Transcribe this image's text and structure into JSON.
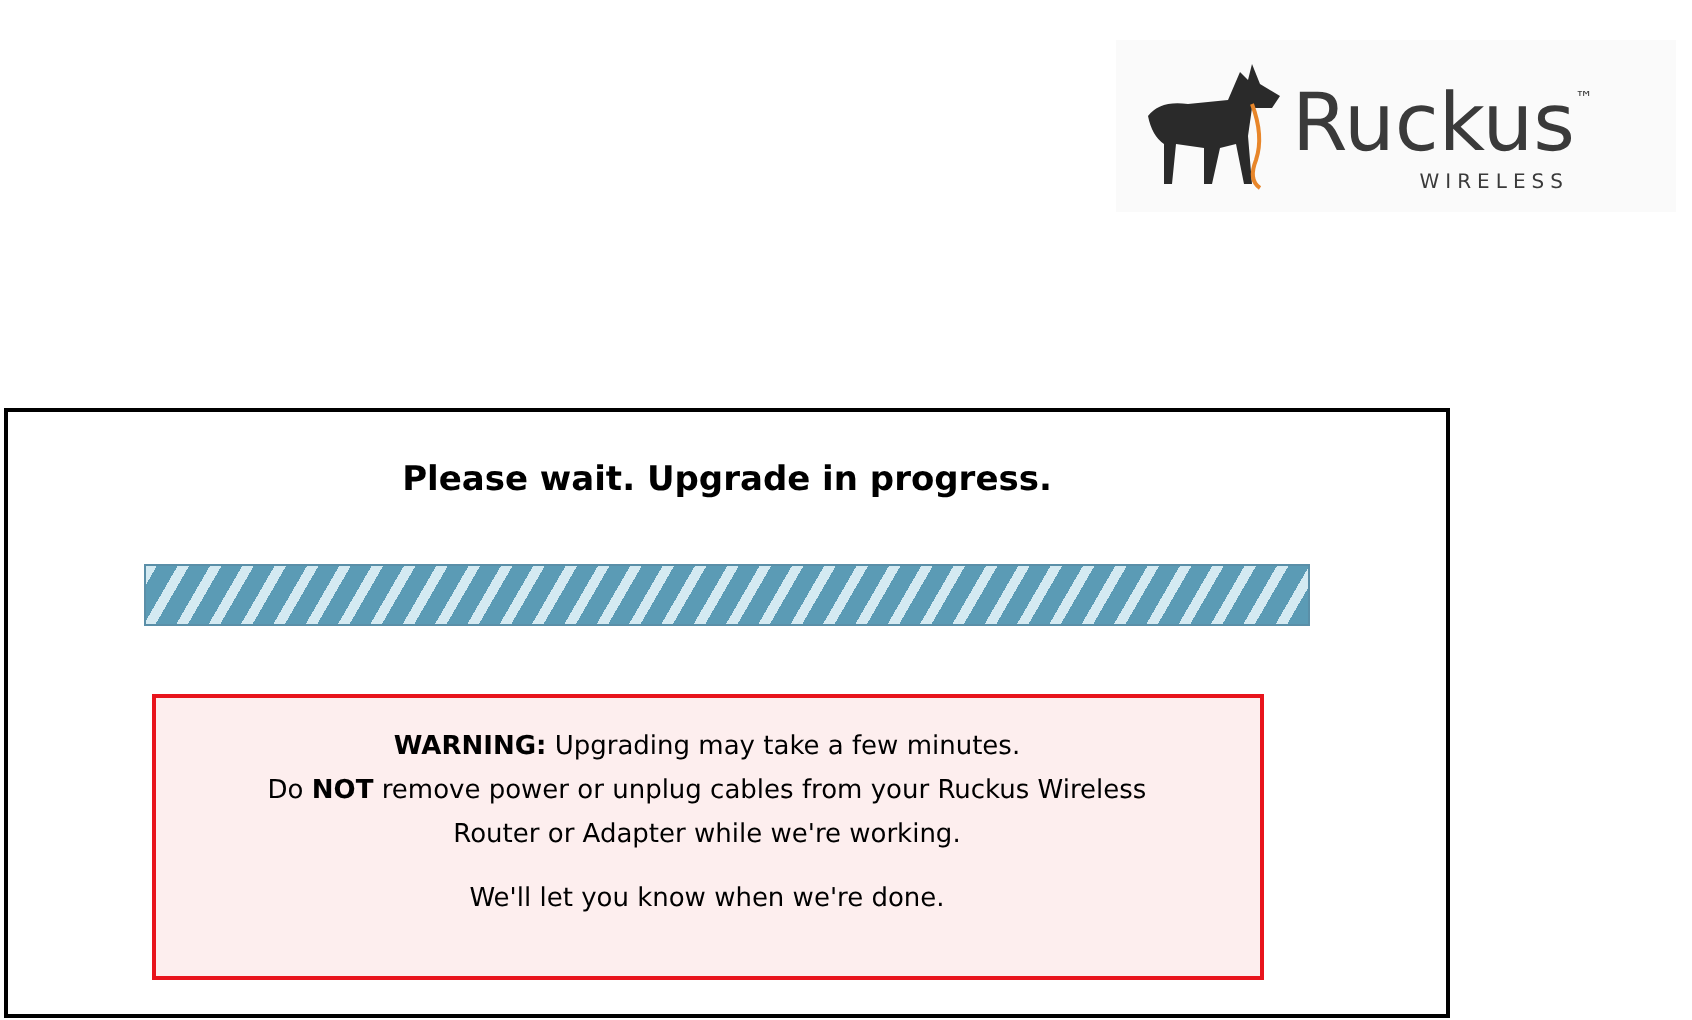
{
  "logo": {
    "name": "Ruckus",
    "trademark": "™",
    "tagline": "WIRELESS"
  },
  "status": {
    "title": "Please wait. Upgrade in progress.",
    "warning_lines": [
      "**WARNING:** Upgrading may take a few minutes.",
      "Do **NOT** remove power or unplug cables from your Ruckus Wireless",
      "Router or Adapter while we're working."
    ],
    "note": "We'll let you know when we're done.",
    "progress": {
      "level": 1
    }
  }
}
